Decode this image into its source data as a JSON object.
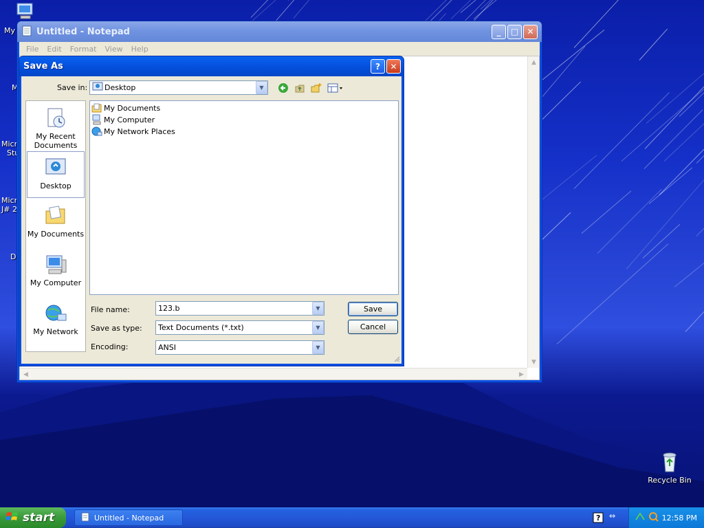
{
  "desktop": {
    "recycle_bin": "Recycle Bin",
    "frag_my": "My",
    "frag_m": "M",
    "frag_micro1": "Micro",
    "frag_stu": "Stu",
    "frag_micro2": "Micro",
    "frag_j": "J# 2",
    "frag_d": "D"
  },
  "notepad": {
    "title": "Untitled - Notepad",
    "menu": [
      "File",
      "Edit",
      "Format",
      "View",
      "Help"
    ]
  },
  "dialog": {
    "title": "Save As",
    "save_in_label": "Save in:",
    "save_in_value": "Desktop",
    "places": [
      "My Recent Documents",
      "Desktop",
      "My Documents",
      "My Computer",
      "My Network"
    ],
    "files": [
      "My Documents",
      "My Computer",
      "My Network Places"
    ],
    "file_name_label": "File name:",
    "file_name_value": "123.b",
    "save_type_label": "Save as type:",
    "save_type_value": "Text Documents (*.txt)",
    "encoding_label": "Encoding:",
    "encoding_value": "ANSI",
    "save_button": "Save",
    "cancel_button": "Cancel"
  },
  "taskbar": {
    "start": "start",
    "task_item": "Untitled - Notepad",
    "clock": "12:58 PM"
  }
}
